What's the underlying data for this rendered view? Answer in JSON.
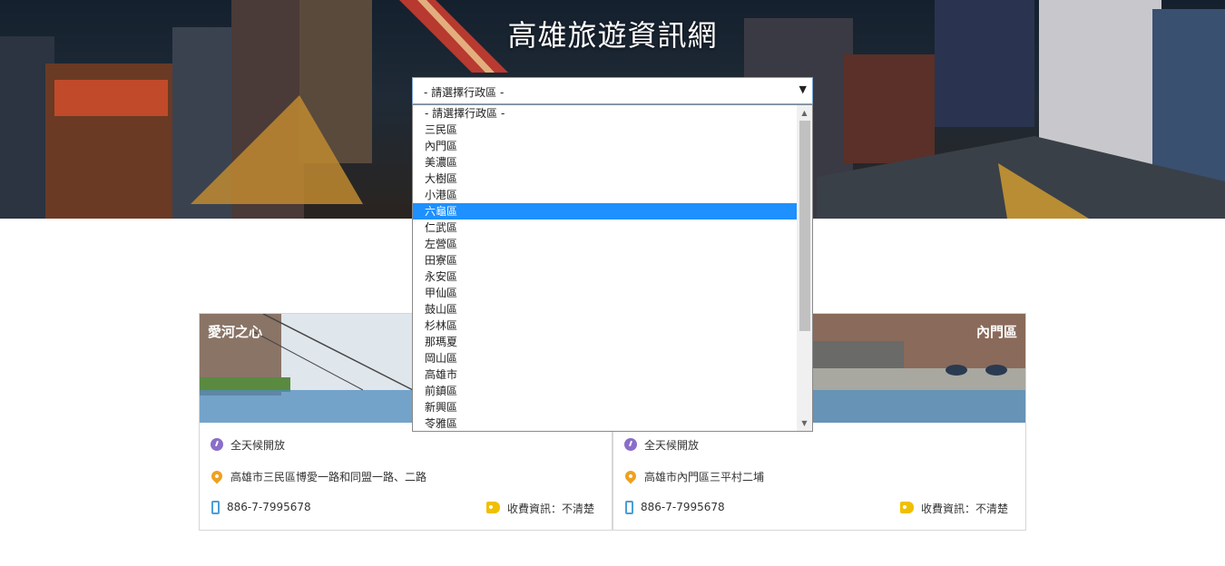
{
  "header": {
    "title": "高雄旅遊資訊網"
  },
  "district_select": {
    "selected_label": "- 請選擇行政區 -",
    "options": [
      "- 請選擇行政區 -",
      "三民區",
      "內門區",
      "美濃區",
      "大樹區",
      "小港區",
      "六龜區",
      "仁武區",
      "左營區",
      "田寮區",
      "永安區",
      "甲仙區",
      "鼓山區",
      "杉林區",
      "那瑪夏",
      "岡山區",
      "高雄市",
      "前鎮區",
      "新興區",
      "苓雅區"
    ],
    "highlighted_option": "六龜區"
  },
  "cards": [
    {
      "name": "愛河之心",
      "open_time": "全天候開放",
      "address": "高雄市三民區博愛一路和同盟一路、二路",
      "phone": "886-7-7995678",
      "fee": "收費資訊：不清楚"
    },
    {
      "name": "內門區",
      "open_time": "全天候開放",
      "address": "高雄市內門區三平村二埔",
      "phone": "886-7-7995678",
      "fee": "收費資訊：不清楚"
    }
  ],
  "colors": {
    "highlight": "#1e90ff",
    "card_bar": "#508cbe",
    "clock": "#8a6ec8",
    "pin": "#f0a020",
    "phone": "#4a9ed8",
    "tag": "#f0c000"
  }
}
